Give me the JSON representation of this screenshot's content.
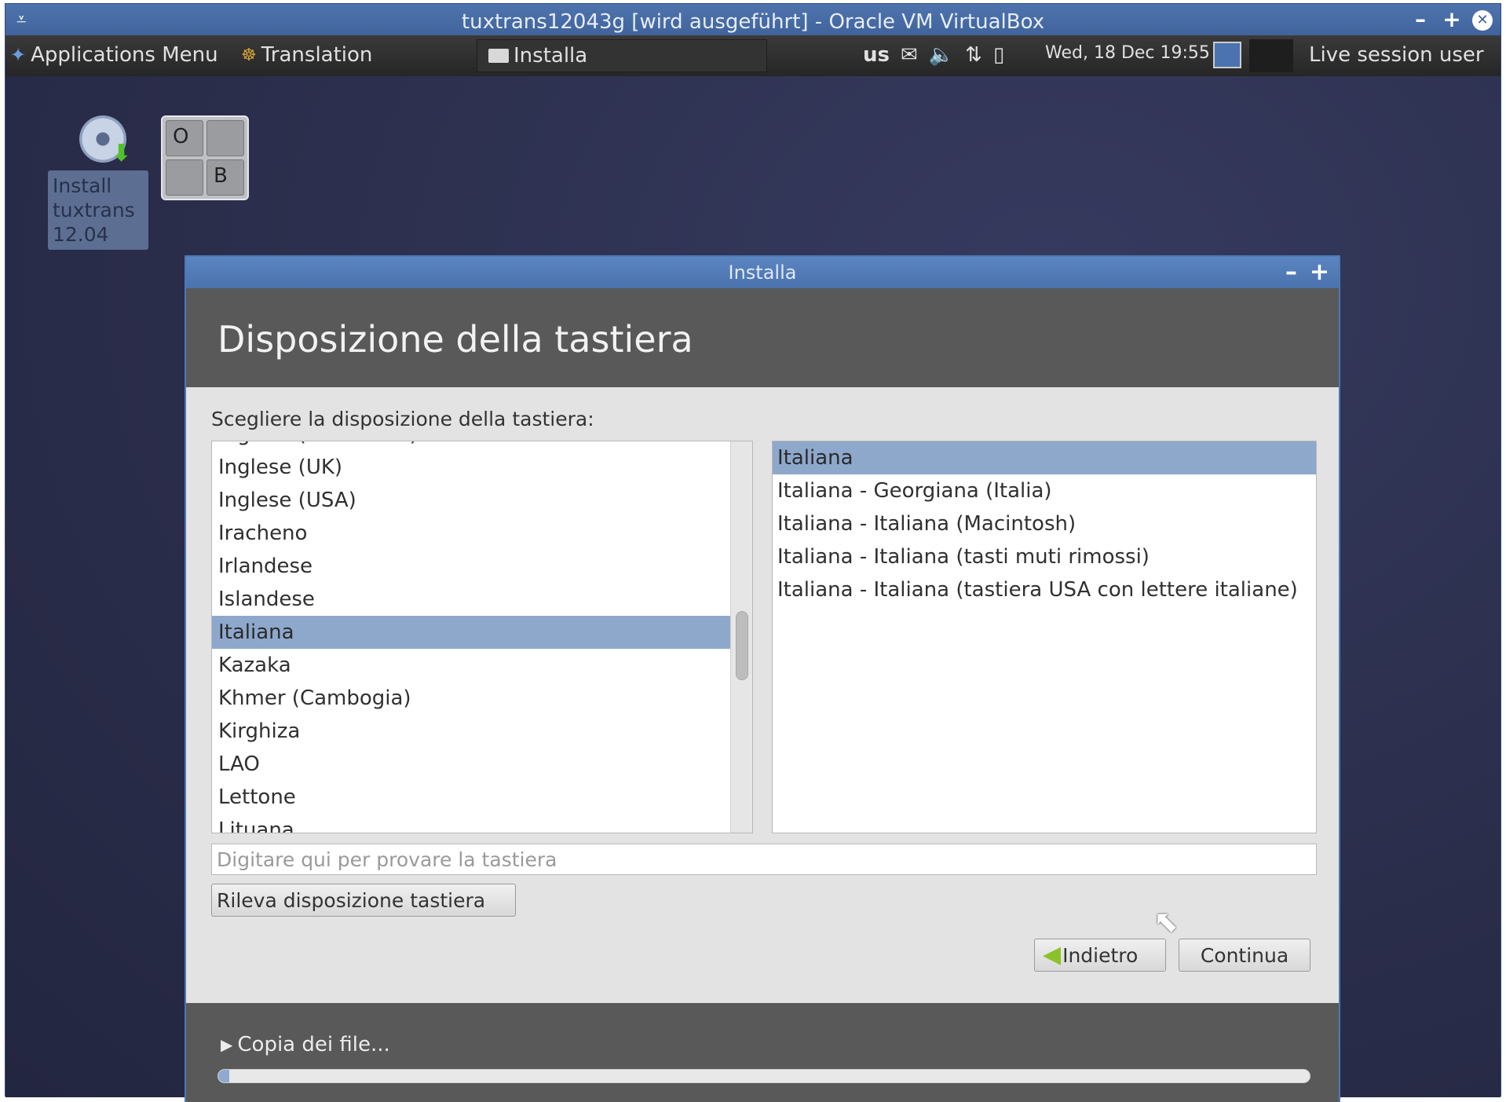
{
  "vbox": {
    "title": "tuxtrans12043g [wird ausgeführt] - Oracle VM VirtualBox",
    "minimize": "–",
    "maximize": "+",
    "close": "✕"
  },
  "panel": {
    "app_menu": "Applications Menu",
    "translation": "Translation",
    "task": "Installa",
    "keyboard": "us",
    "clock": "Wed, 18 Dec 19:55",
    "user": "Live session user"
  },
  "desktop": {
    "icon_label": "Install tuxtrans 12.04",
    "workspaces": [
      "O",
      "",
      "",
      "B"
    ]
  },
  "dialog": {
    "title": "Installa",
    "heading": "Disposizione della tastiera",
    "prompt": "Scegliere la disposizione della tastiera:",
    "layouts": [
      "Inglese (Sud Africa)",
      "Inglese (UK)",
      "Inglese (USA)",
      "Iracheno",
      "Irlandese",
      "Islandese",
      "Italiana",
      "Kazaka",
      "Khmer (Cambogia)",
      "Kirghiza",
      "LAO",
      "Lettone",
      "Lituana"
    ],
    "variants": [
      "Italiana",
      "Italiana - Georgiana (Italia)",
      "Italiana - Italiana (Macintosh)",
      "Italiana - Italiana (tasti muti rimossi)",
      "Italiana - Italiana (tastiera USA con lettere italiane)"
    ],
    "test_placeholder": "Digitare qui per provare la tastiera",
    "detect_button": "Rileva disposizione tastiera",
    "back_button": "Indietro",
    "continue_button": "Continua",
    "progress_label": "Copia dei file...",
    "progress_value": 0.01
  },
  "colors": {
    "selection": "#8ea8cc",
    "dialog_header": "#595959",
    "vbox_titlebar": "#4f74ad"
  }
}
